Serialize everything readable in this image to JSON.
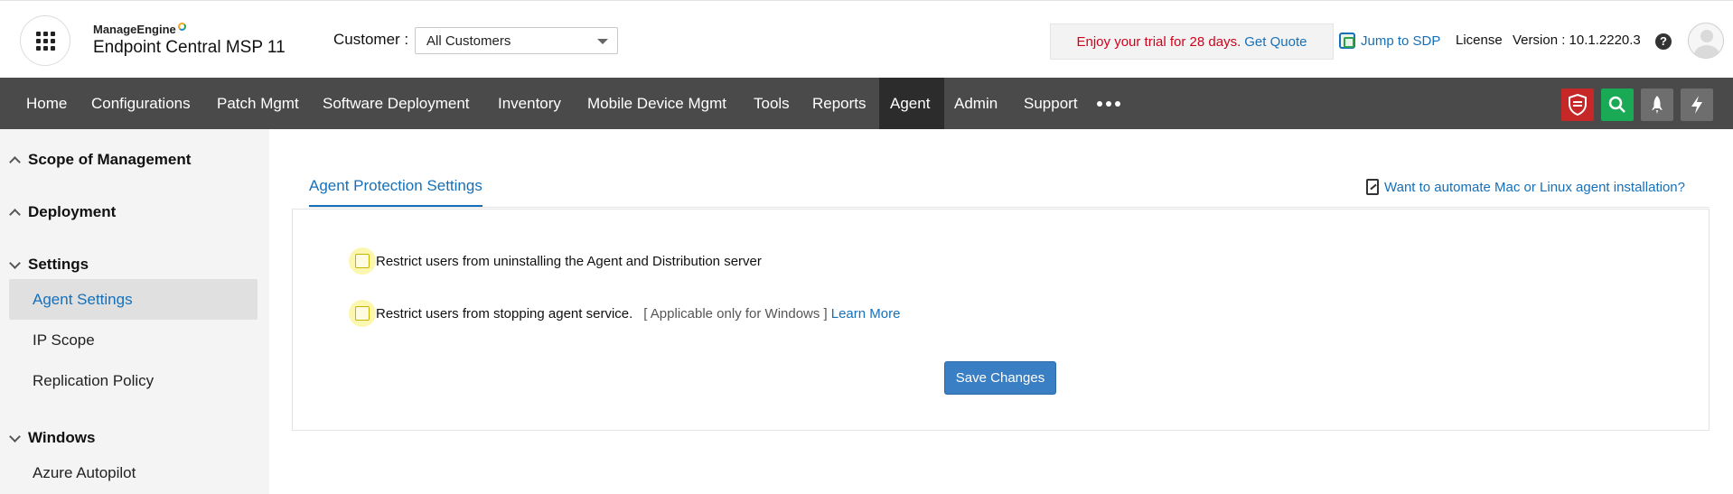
{
  "header": {
    "brand_small": "ManageEngine",
    "brand_product": "Endpoint Central",
    "brand_suffix": "MSP 11",
    "customer_label": "Customer :",
    "customer_selected": "All Customers",
    "trial_text": "Enjoy your trial for 28 days.",
    "trial_link": "Get Quote",
    "jump_sdp": "Jump to SDP",
    "license": "License",
    "version": "Version : 10.1.2220.3",
    "help_glyph": "?"
  },
  "nav": {
    "items": [
      {
        "label": "Home"
      },
      {
        "label": "Configurations"
      },
      {
        "label": "Patch Mgmt"
      },
      {
        "label": "Software Deployment"
      },
      {
        "label": "Inventory"
      },
      {
        "label": "Mobile Device Mgmt"
      },
      {
        "label": "Tools"
      },
      {
        "label": "Reports"
      },
      {
        "label": "Agent"
      },
      {
        "label": "Admin"
      },
      {
        "label": "Support"
      }
    ],
    "active": "Agent",
    "right_icons": [
      "shield-icon",
      "search-icon",
      "rocket-icon",
      "bolt-icon"
    ],
    "colors": {
      "bar": "#4a4a4a",
      "active": "#2c2c2c",
      "shield": "#c62828",
      "search": "#1aaa55"
    }
  },
  "sidebar": {
    "sections": [
      {
        "title": "Scope of Management",
        "state": "collapsed"
      },
      {
        "title": "Deployment",
        "state": "collapsed"
      },
      {
        "title": "Settings",
        "state": "expanded",
        "items": [
          "Agent Settings",
          "IP Scope",
          "Replication Policy"
        ],
        "active": "Agent Settings"
      },
      {
        "title": "Windows",
        "state": "expanded",
        "items": [
          "Azure Autopilot"
        ]
      }
    ]
  },
  "main": {
    "tab": "Agent Protection Settings",
    "automate_link": "Want to automate Mac or Linux agent installation?",
    "options": [
      {
        "label": "Restrict users from uninstalling the Agent and Distribution server",
        "checked": false
      },
      {
        "label": "Restrict users from stopping agent service.",
        "note": "[ Applicable only for Windows ]",
        "link": "Learn More",
        "checked": false
      }
    ],
    "save_button": "Save Changes",
    "accent": "#1670b9"
  }
}
